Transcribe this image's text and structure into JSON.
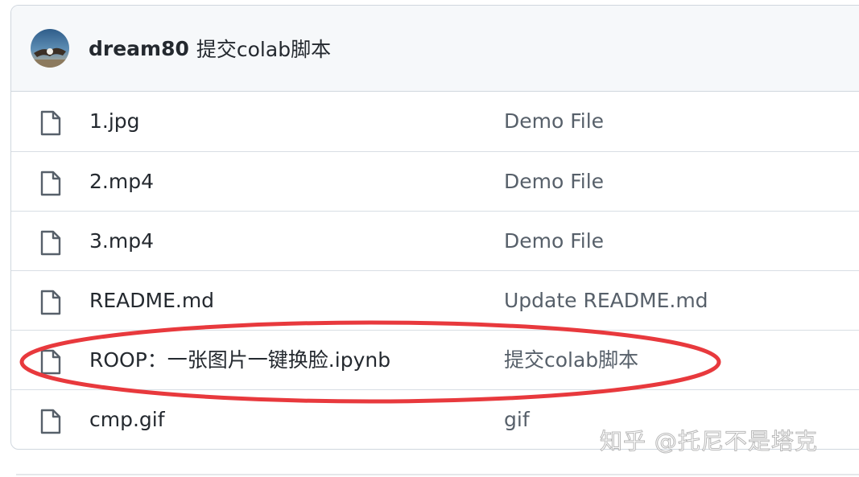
{
  "commit": {
    "user": "dream80",
    "message": "提交colab脚本"
  },
  "files": [
    {
      "name": "1.jpg",
      "commit_message": "Demo File",
      "icon": "file-icon"
    },
    {
      "name": "2.mp4",
      "commit_message": "Demo File",
      "icon": "file-icon"
    },
    {
      "name": "3.mp4",
      "commit_message": "Demo File",
      "icon": "file-icon"
    },
    {
      "name": "README.md",
      "commit_message": "Update README.md",
      "icon": "file-icon"
    },
    {
      "name": "ROOP：一张图片一键换脸.ipynb",
      "commit_message": "提交colab脚本",
      "icon": "file-icon"
    },
    {
      "name": "cmp.gif",
      "commit_message": "gif",
      "icon": "file-icon"
    }
  ],
  "watermark": "知乎 @托尼不是塔克",
  "colors": {
    "highlight": "#e8393d",
    "border": "#d0d7de",
    "header_bg": "#f6f8fa",
    "text": "#24292f",
    "muted": "#57606a"
  }
}
